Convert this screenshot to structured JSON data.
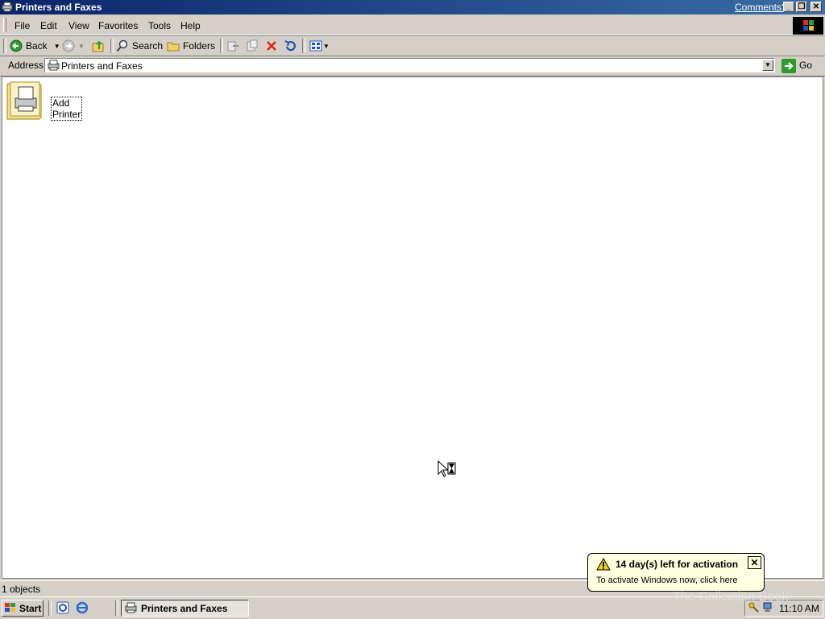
{
  "window": {
    "title": "Printers and Faxes",
    "comments_link": "Comments?"
  },
  "menu": [
    "File",
    "Edit",
    "View",
    "Favorites",
    "Tools",
    "Help"
  ],
  "toolbar": {
    "back_label": "Back",
    "search_label": "Search",
    "folders_label": "Folders"
  },
  "address": {
    "label": "Address",
    "value": "Printers and Faxes",
    "go_label": "Go"
  },
  "content": {
    "items": [
      {
        "label": "Add Printer",
        "icon": "add-printer-icon"
      }
    ]
  },
  "statusbar": {
    "text": "1 objects"
  },
  "taskbar": {
    "start_label": "Start",
    "task_label": "Printers and Faxes",
    "clock": "11:10 AM"
  },
  "balloon": {
    "title": "14 day(s) left for activation",
    "text": "To activate Windows now, click here"
  },
  "watermark": "The Collection Book",
  "colors": {
    "titlebar": "#0a246a",
    "balloon": "#ffffe1",
    "face": "#d4d0c8"
  }
}
